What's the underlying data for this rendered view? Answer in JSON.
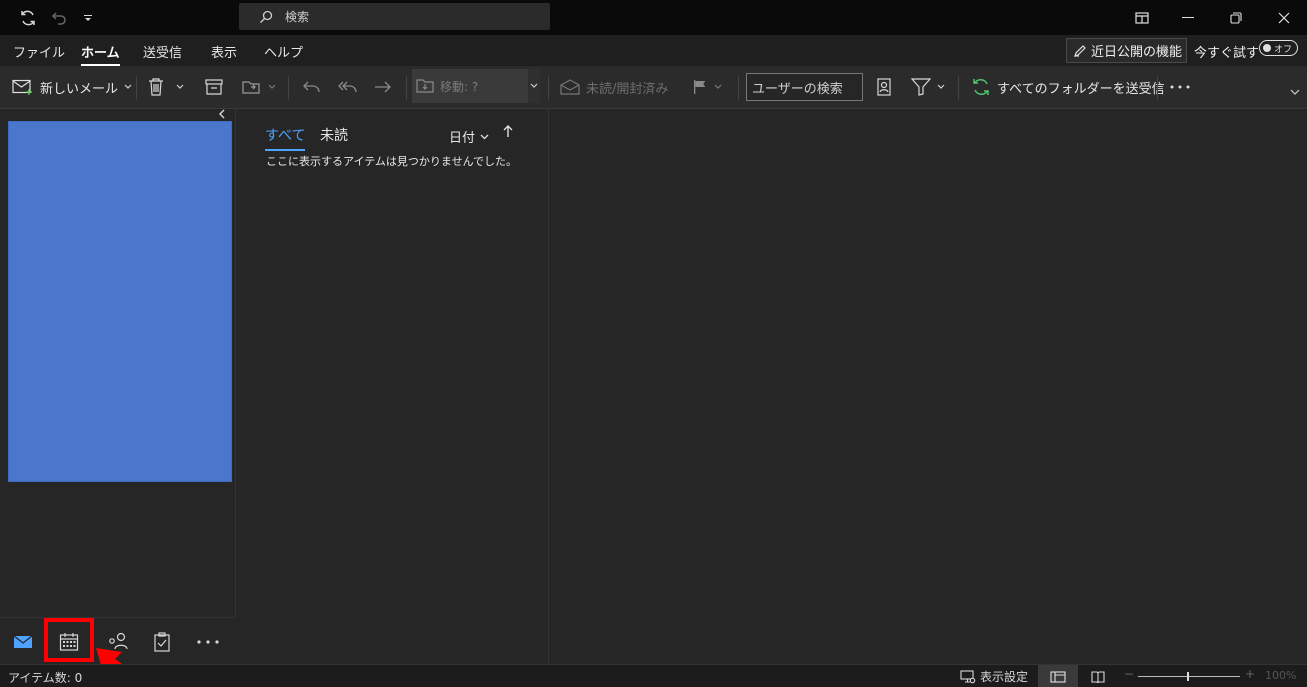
{
  "titlebar": {
    "search_placeholder": "検索"
  },
  "menu": {
    "items": [
      "ファイル",
      "ホーム",
      "送受信",
      "表示",
      "ヘルプ"
    ],
    "coming_soon": "近日公開の機能",
    "try_now": "今すぐ試す",
    "toggle_label": "オフ"
  },
  "ribbon": {
    "new_mail": "新しいメール",
    "move": "移動: ?",
    "unread_read": "未読/開封済み",
    "user_search_placeholder": "ユーザーの検索",
    "send_receive_all": "すべてのフォルダーを送受信"
  },
  "message_list": {
    "tab_all": "すべて",
    "tab_unread": "未読",
    "sort": "日付",
    "empty": "ここに表示するアイテムは見つかりませんでした。"
  },
  "statusbar": {
    "item_count": "アイテム数: 0",
    "view_settings": "表示設定",
    "zoom": "100%"
  },
  "colors": {
    "accent": "#4da3ff",
    "folder_panel": "#4a77cc",
    "highlight": "#ff0000"
  }
}
